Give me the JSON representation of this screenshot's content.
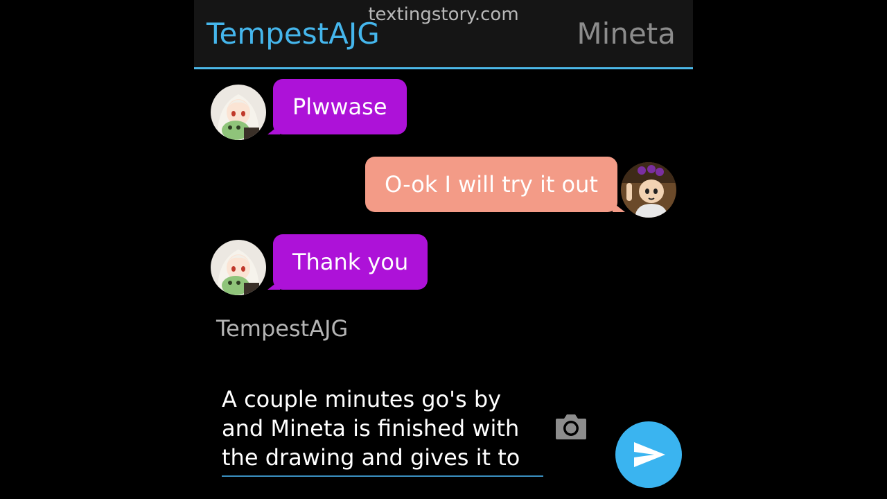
{
  "header": {
    "watermark": "textingstory.com",
    "left_name": "TempestAJG",
    "right_name": "Mineta",
    "accent_color": "#4cb8e8"
  },
  "messages": [
    {
      "side": "left",
      "text": "Plwwase",
      "avatar": "white-haired-girl-avatar"
    },
    {
      "side": "right",
      "text": "O-ok I will try it out",
      "avatar": "mineta-avatar"
    },
    {
      "side": "left",
      "text": "Thank you",
      "avatar": "white-haired-girl-avatar"
    }
  ],
  "composer": {
    "sender_label": "TempestAJG",
    "text": "A couple minutes go's by and Mineta is finished with the drawing and gives it to",
    "camera_icon": "camera-icon",
    "send_icon": "send-icon"
  },
  "colors": {
    "left_bubble": "#ad12d8",
    "right_bubble": "#f39b87",
    "send_button": "#3ab4f0"
  }
}
